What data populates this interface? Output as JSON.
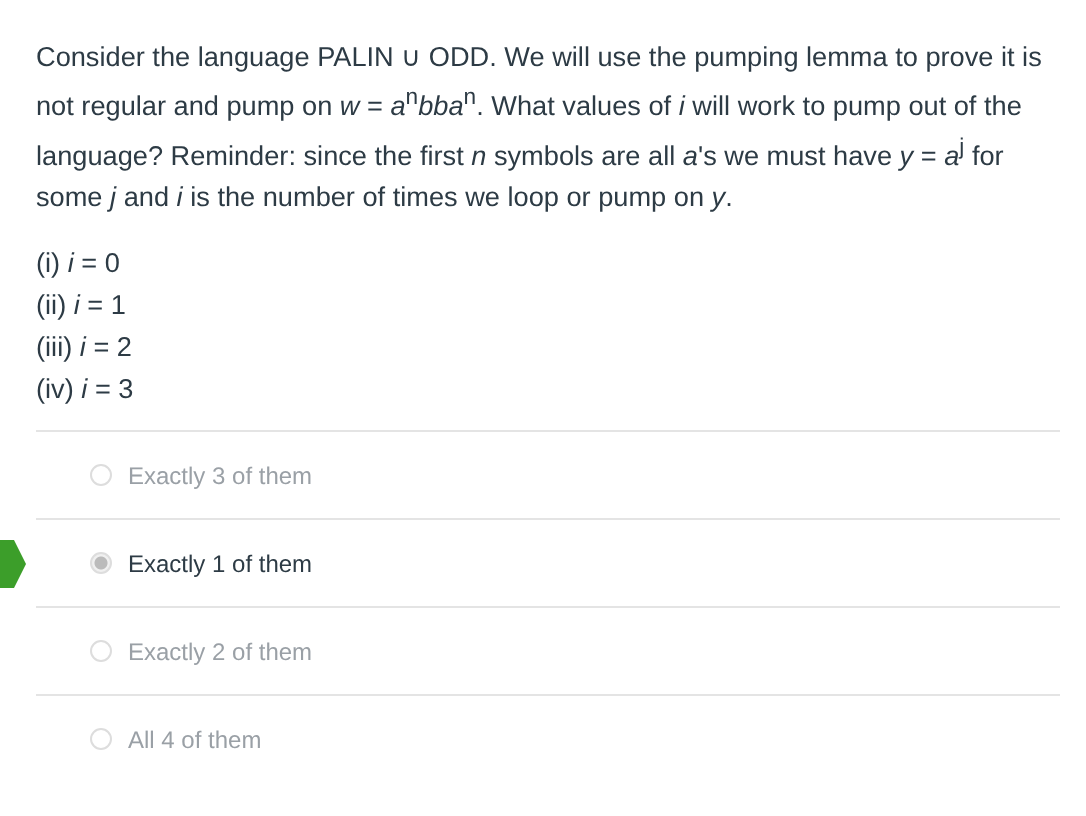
{
  "question": {
    "text": "Consider the language PALIN ∪ ODD. We will use the pumping lemma to prove it is not regular and pump on *w* = *a*$^{n}$*bba*$^{n}$. What values of *i* will work to pump out of the language? Reminder: since the first *n* symbols are all *a*'s we must have *y* = *a*$^{j}$ for some *j* and *i* is the number of times we loop or pump on *y*.",
    "options": [
      "(i) *i* = 0",
      "(ii) *i* = 1",
      "(iii) *i* = 2",
      "(iv) *i* = 3"
    ]
  },
  "answers": [
    {
      "label": "Exactly 3 of them",
      "selected": false,
      "marked": false
    },
    {
      "label": "Exactly 1 of them",
      "selected": true,
      "marked": true
    },
    {
      "label": "Exactly 2 of them",
      "selected": false,
      "marked": false
    },
    {
      "label": "All 4 of them",
      "selected": false,
      "marked": false
    }
  ]
}
